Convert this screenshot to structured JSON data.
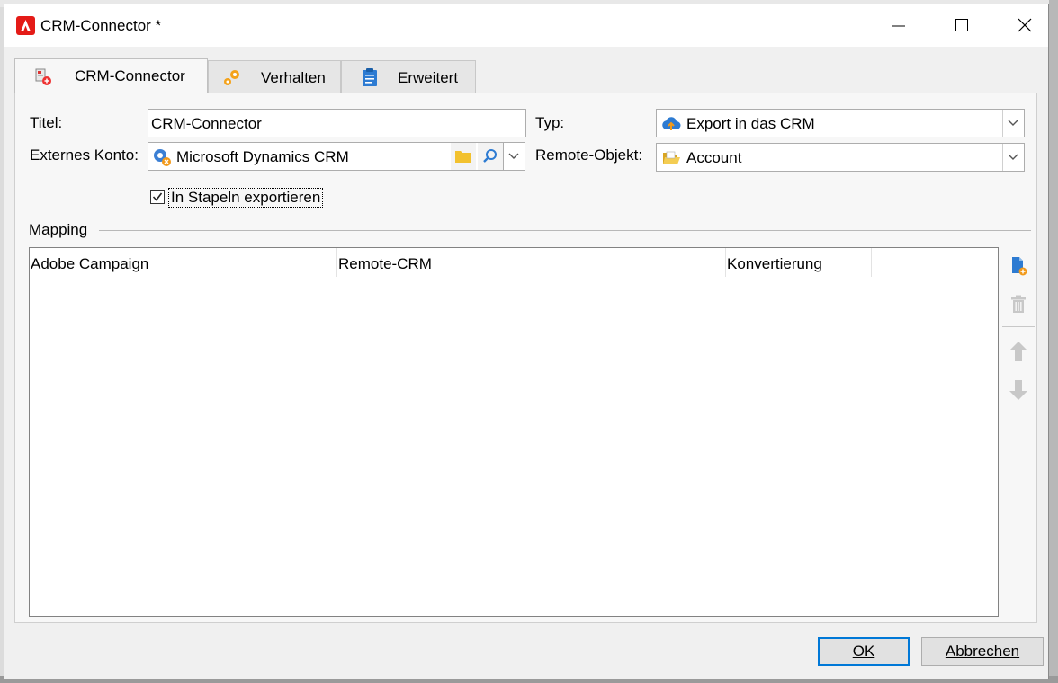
{
  "window": {
    "title": "CRM-Connector *"
  },
  "tabs": [
    {
      "label": "CRM-Connector",
      "icon": "crm-connector-icon",
      "active": true
    },
    {
      "label": "Verhalten",
      "icon": "gears-icon",
      "active": false
    },
    {
      "label": "Erweitert",
      "icon": "clipboard-icon",
      "active": false
    }
  ],
  "form": {
    "titel_label": "Titel:",
    "titel_value": "CRM-Connector",
    "konto_label": "Externes Konto:",
    "konto_value": "Microsoft Dynamics CRM",
    "typ_label": "Typ:",
    "typ_value": "Export in das CRM",
    "remote_label": "Remote-Objekt:",
    "remote_value": "Account",
    "batch_label": "In Stapeln exportieren",
    "batch_checked": true
  },
  "mapping": {
    "group_label": "Mapping",
    "columns": [
      "Adobe Campaign",
      "Remote-CRM",
      "Konvertierung"
    ],
    "rows": []
  },
  "buttons": {
    "ok_label": "OK",
    "cancel_label": "Abbrechen"
  },
  "colors": {
    "accent": "#0078d7",
    "brand": "#e41b17",
    "folder": "#f2c12e"
  }
}
